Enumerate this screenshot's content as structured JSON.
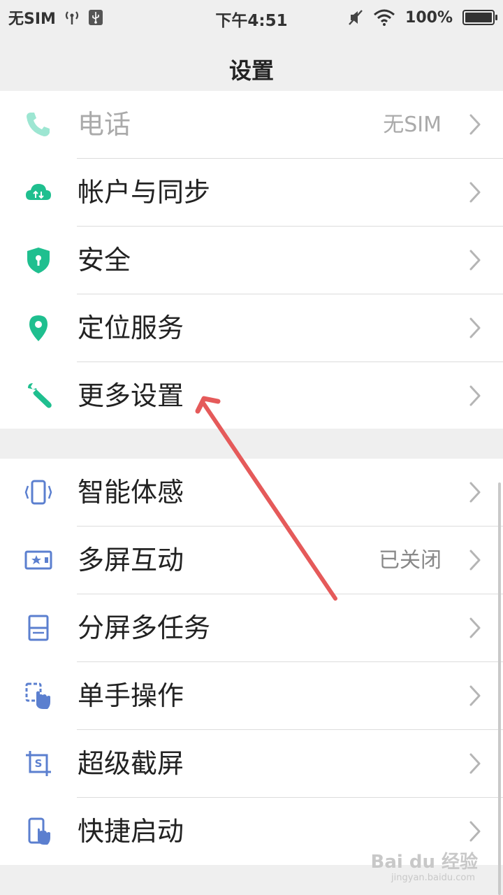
{
  "status_bar": {
    "carrier": "无SIM",
    "time": "下午4:51",
    "battery": "100%",
    "battery_level": 1.0
  },
  "header": {
    "title": "设置"
  },
  "items_top": [
    {
      "label": "电话",
      "value": "无SIM",
      "icon": "phone-icon",
      "color": "#3dcfa7"
    },
    {
      "label": "帐户与同步",
      "value": "",
      "icon": "cloud-sync-icon",
      "color": "#1fbf8f"
    },
    {
      "label": "安全",
      "value": "",
      "icon": "shield-icon",
      "color": "#1fbf8f"
    },
    {
      "label": "定位服务",
      "value": "",
      "icon": "location-pin-icon",
      "color": "#1fbf8f"
    },
    {
      "label": "更多设置",
      "value": "",
      "icon": "wrench-icon",
      "color": "#1fbf8f"
    }
  ],
  "items_bottom": [
    {
      "label": "智能体感",
      "value": "",
      "icon": "motion-phone-icon",
      "color": "#5b7fcf"
    },
    {
      "label": "多屏互动",
      "value": "已关闭",
      "icon": "multiscreen-icon",
      "color": "#5b7fcf"
    },
    {
      "label": "分屏多任务",
      "value": "",
      "icon": "split-screen-icon",
      "color": "#5b7fcf"
    },
    {
      "label": "单手操作",
      "value": "",
      "icon": "one-hand-icon",
      "color": "#5b7fcf"
    },
    {
      "label": "超级截屏",
      "value": "",
      "icon": "screenshot-icon",
      "color": "#5b7fcf"
    },
    {
      "label": "快捷启动",
      "value": "",
      "icon": "quick-launch-icon",
      "color": "#5b7fcf"
    }
  ],
  "watermark": {
    "text": "Bai du 经验",
    "sub": "jingyan.baidu.com"
  },
  "colors": {
    "annotation_arrow": "#e55a5a",
    "chevron": "#b5b5b5"
  }
}
